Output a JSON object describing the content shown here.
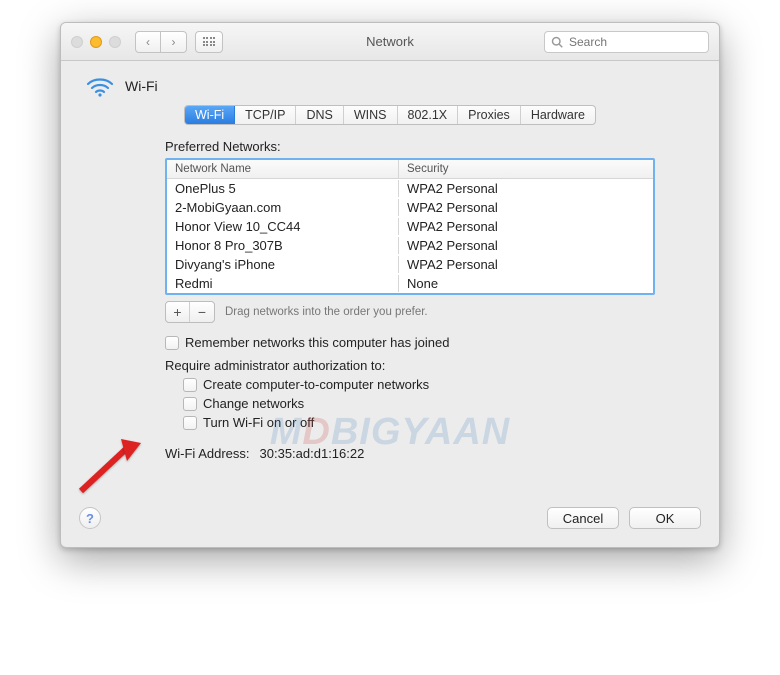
{
  "window": {
    "title": "Network",
    "search_placeholder": "Search"
  },
  "header": {
    "label": "Wi-Fi"
  },
  "tabs": [
    "Wi-Fi",
    "TCP/IP",
    "DNS",
    "WINS",
    "802.1X",
    "Proxies",
    "Hardware"
  ],
  "active_tab_index": 0,
  "preferred_label": "Preferred Networks:",
  "table": {
    "columns": [
      "Network Name",
      "Security"
    ],
    "rows": [
      {
        "name": "OnePlus 5",
        "security": "WPA2 Personal"
      },
      {
        "name": "2-MobiGyaan.com",
        "security": "WPA2 Personal"
      },
      {
        "name": "Honor View 10_CC44",
        "security": "WPA2 Personal"
      },
      {
        "name": "Honor 8 Pro_307B",
        "security": "WPA2 Personal"
      },
      {
        "name": "Divyang's iPhone",
        "security": "WPA2 Personal"
      },
      {
        "name": "Redmi",
        "security": "None"
      }
    ]
  },
  "drag_hint": "Drag networks into the order you prefer.",
  "remember_label": "Remember networks this computer has joined",
  "require_label": "Require administrator authorization to:",
  "auth_options": [
    "Create computer-to-computer networks",
    "Change networks",
    "Turn Wi-Fi on or off"
  ],
  "wifi_address": {
    "label": "Wi-Fi Address:",
    "value": "30:35:ad:d1:16:22"
  },
  "buttons": {
    "cancel": "Cancel",
    "ok": "OK"
  },
  "watermark": {
    "pre": "M",
    "d": "D",
    "rest": "BIGYAAN"
  }
}
